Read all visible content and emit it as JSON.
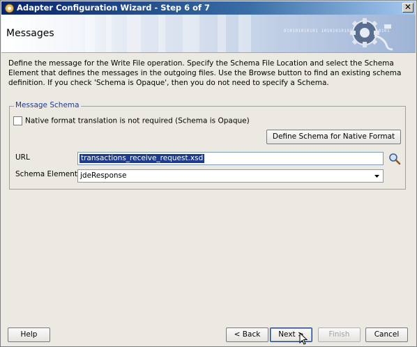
{
  "window": {
    "title": "Adapter Configuration Wizard - Step 6 of 7",
    "close_label": "✕"
  },
  "banner": {
    "title": "Messages",
    "binary_text": "010101010101 1010101010101 0101010101"
  },
  "description": "Define the message for the Write File operation.  Specify the Schema File Location and select the Schema Element that defines the messages in the outgoing files. Use the Browse button to find an existing schema definition. If you check 'Schema is Opaque', then you do not need to specify a Schema.",
  "schema_group": {
    "legend": "Message Schema",
    "opaque_checkbox_label": "Native format translation is not required (Schema is Opaque)",
    "opaque_checked": false,
    "define_schema_button": "Define Schema for Native Format",
    "url_label": "URL",
    "url_value": "transactions_receive_request.xsd",
    "schema_element_label": "Schema Element",
    "schema_element_value": "jdeResponse"
  },
  "footer": {
    "help_button": "Help",
    "back_button": "< Back",
    "next_button": "Next >",
    "finish_button": "Finish",
    "cancel_button": "Cancel"
  }
}
